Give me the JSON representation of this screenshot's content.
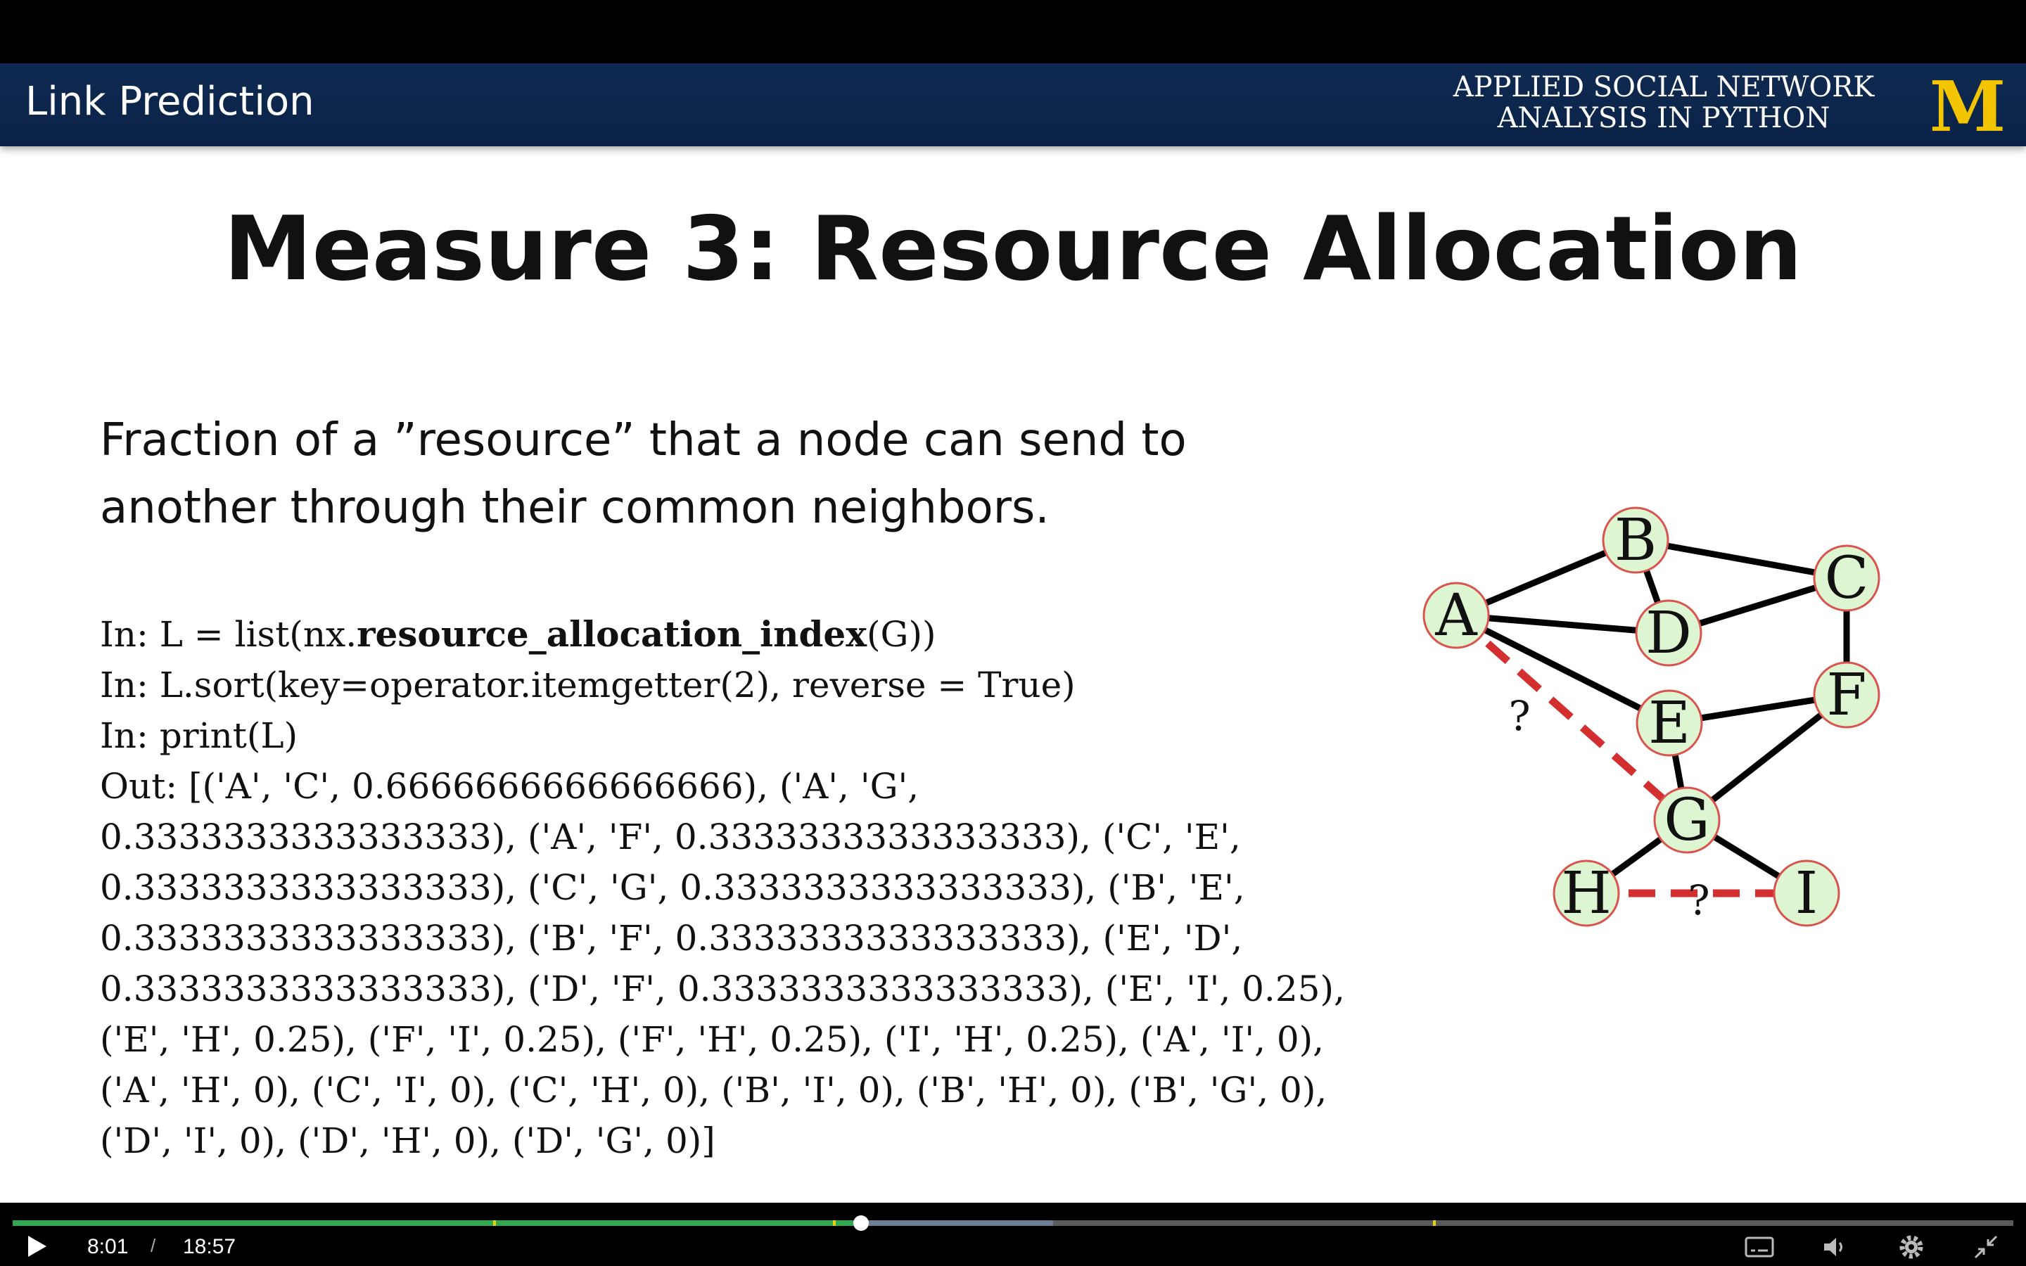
{
  "header": {
    "title": "Link Prediction",
    "course_line1": "APPLIED SOCIAL NETWORK",
    "course_line2": "ANALYSIS IN PYTHON",
    "logo_letter": "M"
  },
  "slide": {
    "title": "Measure 3: Resource Allocation",
    "description_line1": "Fraction of a ”resource” that a node can send to",
    "description_line2": "another through their common neighbors.",
    "code": {
      "line1_prefix": "In: L = list(nx.",
      "line1_bold": "resource_allocation_index",
      "line1_suffix": "(G))",
      "line2": "In: L.sort(key=operator.itemgetter(2), reverse = True)",
      "line3": "In: print(L)",
      "out_lines": [
        "Out: [('A', 'C', 0.6666666666666666), ('A', 'G',",
        "0.3333333333333333), ('A', 'F', 0.3333333333333333), ('C', 'E',",
        "0.3333333333333333), ('C', 'G', 0.3333333333333333), ('B', 'E',",
        "0.3333333333333333), ('B', 'F', 0.3333333333333333), ('E', 'D',",
        "0.3333333333333333), ('D', 'F', 0.3333333333333333), ('E', 'I', 0.25),",
        "('E', 'H', 0.25), ('F', 'I', 0.25), ('F', 'H', 0.25), ('I', 'H', 0.25), ('A', 'I', 0),",
        "('A', 'H', 0), ('C', 'I', 0), ('C', 'H', 0), ('B', 'I', 0), ('B', 'H', 0), ('B', 'G', 0),",
        "('D', 'I', 0), ('D', 'H', 0), ('D', 'G', 0)]"
      ]
    },
    "graph": {
      "nodes": [
        "A",
        "B",
        "C",
        "D",
        "E",
        "F",
        "G",
        "H",
        "I"
      ],
      "edges": [
        [
          "A",
          "B"
        ],
        [
          "A",
          "D"
        ],
        [
          "A",
          "E"
        ],
        [
          "B",
          "D"
        ],
        [
          "B",
          "C"
        ],
        [
          "C",
          "D"
        ],
        [
          "C",
          "F"
        ],
        [
          "E",
          "F"
        ],
        [
          "E",
          "G"
        ],
        [
          "F",
          "G"
        ],
        [
          "G",
          "H"
        ],
        [
          "G",
          "I"
        ]
      ],
      "candidate_edges": [
        [
          "A",
          "G"
        ],
        [
          "H",
          "I"
        ]
      ],
      "question_mark": "?",
      "node_fill": "#ddf5d0",
      "node_stroke": "#d9534f",
      "candidate_color": "#d32f2f"
    }
  },
  "player": {
    "current_time": "8:01",
    "separator": "/",
    "duration": "18:57",
    "played_fraction": 0.424,
    "buffered_fraction": 0.52,
    "chapter_marks": [
      0.24,
      0.41,
      0.71
    ],
    "icons": [
      "play-icon",
      "captions-icon",
      "volume-icon",
      "settings-icon",
      "exit-fullscreen-icon"
    ],
    "accent_color": "#2fa84f"
  }
}
